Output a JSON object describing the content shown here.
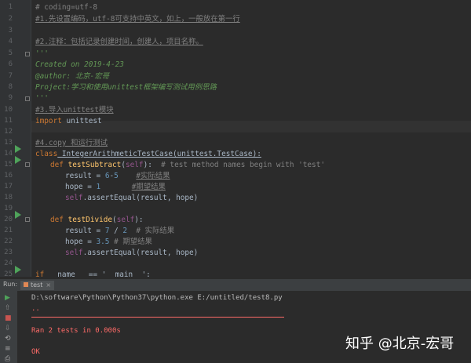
{
  "editor": {
    "lines": [
      {
        "num": "1",
        "code": "# coding=utf-8"
      },
      {
        "num": "2",
        "code": "#1.先设置编码，utf-8可支持中英文，如上，一般放在第一行"
      },
      {
        "num": "3",
        "code": ""
      },
      {
        "num": "4",
        "code": "#2.注释：包括记录创建时间，创建人，项目名称。"
      },
      {
        "num": "5",
        "code": "'''"
      },
      {
        "num": "6",
        "code": "Created on 2019-4-23"
      },
      {
        "num": "7",
        "code": "@author: 北京-宏哥"
      },
      {
        "num": "8",
        "code": "Project:学习和使用unittest框架编写测试用例思路"
      },
      {
        "num": "9",
        "code": "'''"
      },
      {
        "num": "10",
        "code": "#3.导入unittest模块"
      },
      {
        "num": "11",
        "kw": "import",
        "rest": " unittest"
      },
      {
        "num": "12",
        "code": ""
      },
      {
        "num": "13",
        "code": "#4.copy 和运行测试"
      },
      {
        "num": "14",
        "kw": "class",
        "rest": " IntegerArithmeticTestCase(unittest.TestCase):"
      },
      {
        "num": "15",
        "kw": "def",
        "fn": "testSubtract",
        "self": "self",
        "tail": "):  ",
        "cm": "# test method names begin with 'test'"
      },
      {
        "num": "16",
        "pre": "result = ",
        "num1": "6",
        "op": "-",
        "num2": "5",
        "cm": "#实际结果"
      },
      {
        "num": "17",
        "pre": "hope = ",
        "num1": "1",
        "cm": "#期望结果"
      },
      {
        "num": "18",
        "self": "self",
        "rest": ".assertEqual(result, hope)"
      },
      {
        "num": "19",
        "code": ""
      },
      {
        "num": "20",
        "kw": "def",
        "fn": "testDivide",
        "self": "self",
        "tail": "):"
      },
      {
        "num": "21",
        "pre": "result = ",
        "num1": "7",
        "op": " / ",
        "num2": "2",
        "cm": "# 实际结果"
      },
      {
        "num": "22",
        "pre": "hope = ",
        "num1": "3.5",
        "cm": "# 期望结果"
      },
      {
        "num": "23",
        "self": "self",
        "rest": ".assertEqual(result, hope)"
      },
      {
        "num": "24",
        "code": ""
      },
      {
        "num": "25",
        "kw": "if",
        "rest": " __name__ == '__main__':"
      }
    ]
  },
  "run": {
    "label": "Run:",
    "tab": "test",
    "tab_close": "×",
    "command": "D:\\software\\Python\\Python37\\python.exe E:/untitled/test8.py",
    "dots": "..",
    "result": "Ran 2 tests in 0.000s",
    "status": "OK",
    "toolbar": [
      "▶",
      "⇧",
      "■",
      "⇩",
      "⟲",
      "≡",
      "⎙",
      "✎"
    ]
  },
  "watermark": "知乎 @北京-宏哥",
  "colors": {
    "run_arrow": "#4fa35a",
    "error_red": "#ff6b68",
    "keyword": "#cc7832"
  }
}
